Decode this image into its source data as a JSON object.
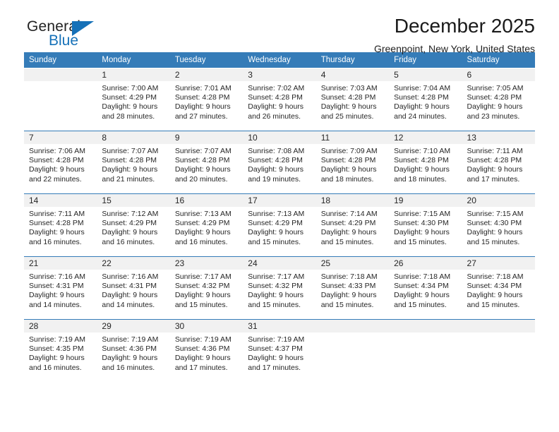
{
  "brand": {
    "name_top": "General",
    "name_bottom": "Blue",
    "color_dark": "#232323",
    "color_blue": "#1671b8"
  },
  "header": {
    "title": "December 2025",
    "subtitle": "Greenpoint, New York, United States"
  },
  "theme": {
    "header_bg": "#357cb8",
    "header_text": "#ffffff",
    "daynum_bg": "#f1f1f1",
    "grid_line": "#357cb8",
    "body_text": "#262626"
  },
  "labels": {
    "sunrise_prefix": "Sunrise:",
    "sunset_prefix": "Sunset:",
    "daylight_prefix": "Daylight:"
  },
  "calendar": {
    "weekday_headers": [
      "Sunday",
      "Monday",
      "Tuesday",
      "Wednesday",
      "Thursday",
      "Friday",
      "Saturday"
    ],
    "weeks": [
      [
        {
          "day": "",
          "empty": true,
          "lines": []
        },
        {
          "day": "1",
          "lines": [
            "Sunrise: 7:00 AM",
            "Sunset: 4:29 PM",
            "Daylight: 9 hours",
            "and 28 minutes."
          ]
        },
        {
          "day": "2",
          "lines": [
            "Sunrise: 7:01 AM",
            "Sunset: 4:28 PM",
            "Daylight: 9 hours",
            "and 27 minutes."
          ]
        },
        {
          "day": "3",
          "lines": [
            "Sunrise: 7:02 AM",
            "Sunset: 4:28 PM",
            "Daylight: 9 hours",
            "and 26 minutes."
          ]
        },
        {
          "day": "4",
          "lines": [
            "Sunrise: 7:03 AM",
            "Sunset: 4:28 PM",
            "Daylight: 9 hours",
            "and 25 minutes."
          ]
        },
        {
          "day": "5",
          "lines": [
            "Sunrise: 7:04 AM",
            "Sunset: 4:28 PM",
            "Daylight: 9 hours",
            "and 24 minutes."
          ]
        },
        {
          "day": "6",
          "lines": [
            "Sunrise: 7:05 AM",
            "Sunset: 4:28 PM",
            "Daylight: 9 hours",
            "and 23 minutes."
          ]
        }
      ],
      [
        {
          "day": "7",
          "lines": [
            "Sunrise: 7:06 AM",
            "Sunset: 4:28 PM",
            "Daylight: 9 hours",
            "and 22 minutes."
          ]
        },
        {
          "day": "8",
          "lines": [
            "Sunrise: 7:07 AM",
            "Sunset: 4:28 PM",
            "Daylight: 9 hours",
            "and 21 minutes."
          ]
        },
        {
          "day": "9",
          "lines": [
            "Sunrise: 7:07 AM",
            "Sunset: 4:28 PM",
            "Daylight: 9 hours",
            "and 20 minutes."
          ]
        },
        {
          "day": "10",
          "lines": [
            "Sunrise: 7:08 AM",
            "Sunset: 4:28 PM",
            "Daylight: 9 hours",
            "and 19 minutes."
          ]
        },
        {
          "day": "11",
          "lines": [
            "Sunrise: 7:09 AM",
            "Sunset: 4:28 PM",
            "Daylight: 9 hours",
            "and 18 minutes."
          ]
        },
        {
          "day": "12",
          "lines": [
            "Sunrise: 7:10 AM",
            "Sunset: 4:28 PM",
            "Daylight: 9 hours",
            "and 18 minutes."
          ]
        },
        {
          "day": "13",
          "lines": [
            "Sunrise: 7:11 AM",
            "Sunset: 4:28 PM",
            "Daylight: 9 hours",
            "and 17 minutes."
          ]
        }
      ],
      [
        {
          "day": "14",
          "lines": [
            "Sunrise: 7:11 AM",
            "Sunset: 4:28 PM",
            "Daylight: 9 hours",
            "and 16 minutes."
          ]
        },
        {
          "day": "15",
          "lines": [
            "Sunrise: 7:12 AM",
            "Sunset: 4:29 PM",
            "Daylight: 9 hours",
            "and 16 minutes."
          ]
        },
        {
          "day": "16",
          "lines": [
            "Sunrise: 7:13 AM",
            "Sunset: 4:29 PM",
            "Daylight: 9 hours",
            "and 16 minutes."
          ]
        },
        {
          "day": "17",
          "lines": [
            "Sunrise: 7:13 AM",
            "Sunset: 4:29 PM",
            "Daylight: 9 hours",
            "and 15 minutes."
          ]
        },
        {
          "day": "18",
          "lines": [
            "Sunrise: 7:14 AM",
            "Sunset: 4:29 PM",
            "Daylight: 9 hours",
            "and 15 minutes."
          ]
        },
        {
          "day": "19",
          "lines": [
            "Sunrise: 7:15 AM",
            "Sunset: 4:30 PM",
            "Daylight: 9 hours",
            "and 15 minutes."
          ]
        },
        {
          "day": "20",
          "lines": [
            "Sunrise: 7:15 AM",
            "Sunset: 4:30 PM",
            "Daylight: 9 hours",
            "and 15 minutes."
          ]
        }
      ],
      [
        {
          "day": "21",
          "lines": [
            "Sunrise: 7:16 AM",
            "Sunset: 4:31 PM",
            "Daylight: 9 hours",
            "and 14 minutes."
          ]
        },
        {
          "day": "22",
          "lines": [
            "Sunrise: 7:16 AM",
            "Sunset: 4:31 PM",
            "Daylight: 9 hours",
            "and 14 minutes."
          ]
        },
        {
          "day": "23",
          "lines": [
            "Sunrise: 7:17 AM",
            "Sunset: 4:32 PM",
            "Daylight: 9 hours",
            "and 15 minutes."
          ]
        },
        {
          "day": "24",
          "lines": [
            "Sunrise: 7:17 AM",
            "Sunset: 4:32 PM",
            "Daylight: 9 hours",
            "and 15 minutes."
          ]
        },
        {
          "day": "25",
          "lines": [
            "Sunrise: 7:18 AM",
            "Sunset: 4:33 PM",
            "Daylight: 9 hours",
            "and 15 minutes."
          ]
        },
        {
          "day": "26",
          "lines": [
            "Sunrise: 7:18 AM",
            "Sunset: 4:34 PM",
            "Daylight: 9 hours",
            "and 15 minutes."
          ]
        },
        {
          "day": "27",
          "lines": [
            "Sunrise: 7:18 AM",
            "Sunset: 4:34 PM",
            "Daylight: 9 hours",
            "and 15 minutes."
          ]
        }
      ],
      [
        {
          "day": "28",
          "lines": [
            "Sunrise: 7:19 AM",
            "Sunset: 4:35 PM",
            "Daylight: 9 hours",
            "and 16 minutes."
          ]
        },
        {
          "day": "29",
          "lines": [
            "Sunrise: 7:19 AM",
            "Sunset: 4:36 PM",
            "Daylight: 9 hours",
            "and 16 minutes."
          ]
        },
        {
          "day": "30",
          "lines": [
            "Sunrise: 7:19 AM",
            "Sunset: 4:36 PM",
            "Daylight: 9 hours",
            "and 17 minutes."
          ]
        },
        {
          "day": "31",
          "lines": [
            "Sunrise: 7:19 AM",
            "Sunset: 4:37 PM",
            "Daylight: 9 hours",
            "and 17 minutes."
          ]
        },
        {
          "day": "",
          "empty": true,
          "lines": []
        },
        {
          "day": "",
          "empty": true,
          "lines": []
        },
        {
          "day": "",
          "empty": true,
          "lines": []
        }
      ]
    ]
  }
}
